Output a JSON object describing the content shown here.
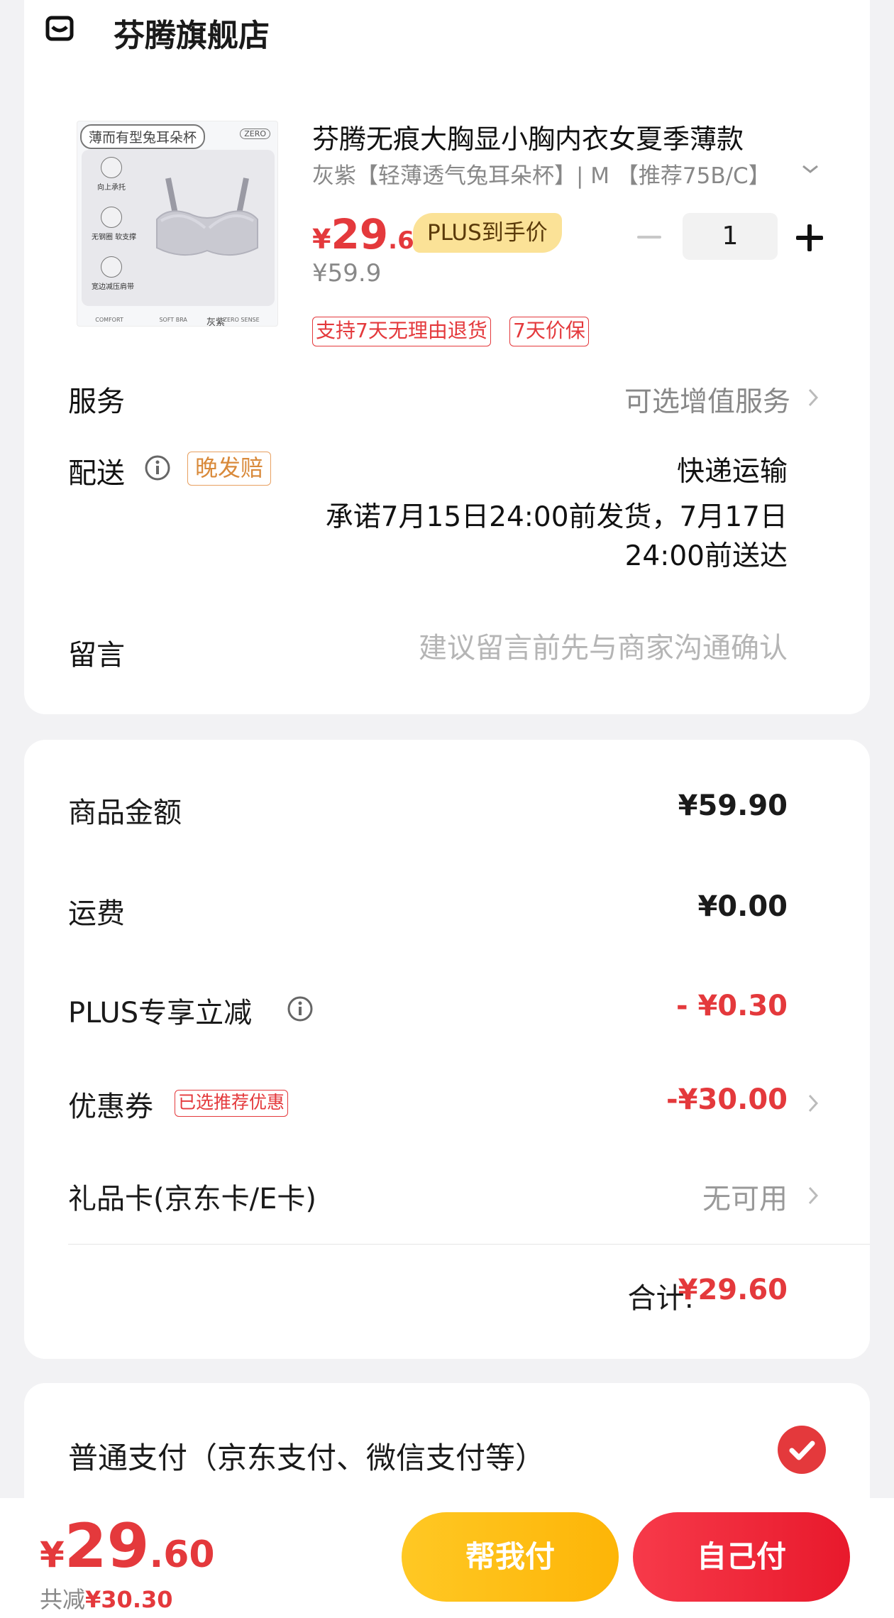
{
  "store": {
    "name": "芬腾旗舰店",
    "icon": "store-icon"
  },
  "product": {
    "title": "芬腾无痕大胸显小胸内衣女夏季薄款",
    "spec": "灰紫【轻薄透气兔耳朵杯】| M 【推荐75B/C】",
    "image_tag": "薄而有型兔耳朵杯",
    "image_badge": "ZERO",
    "image_features": [
      "向上承托",
      "无钢圈 软支撑",
      "宽边减压肩带"
    ],
    "image_color": "灰紫",
    "image_footer": [
      "COMFORT",
      "SOFT BRA",
      "ZERO SENSE"
    ],
    "price_symbol": "¥",
    "price_int": "29",
    "price_dec": ".6",
    "plus_label": "PLUS到手价",
    "original_price": "¥59.9",
    "quantity": "1",
    "badges": [
      "支持7天无理由退货",
      "7天价保"
    ]
  },
  "service": {
    "label": "服务",
    "value": "可选增值服务"
  },
  "delivery": {
    "label": "配送",
    "late_badge": "晚发赔",
    "method": "快递运输",
    "line1": "承诺7月15日24:00前发货，7月17日",
    "line2": "24:00前送达"
  },
  "message": {
    "label": "留言",
    "placeholder": "建议留言前先与商家沟通确认"
  },
  "summary": {
    "goods_label": "商品金额",
    "goods_value": "¥59.90",
    "shipping_label": "运费",
    "shipping_value": "¥0.00",
    "plus_label": "PLUS专享立减",
    "plus_value": "- ¥0.30",
    "coupon_label": "优惠券",
    "coupon_badge": "已选推荐优惠",
    "coupon_value": "-¥30.00",
    "giftcard_label": "礼品卡(京东卡/E卡)",
    "giftcard_value": "无可用",
    "total_label": "合计:",
    "total_value": "¥29.60"
  },
  "payment": {
    "label": "普通支付（京东支付、微信支付等）"
  },
  "bottom": {
    "price_symbol": "¥",
    "price_int": "29",
    "price_dec": ".60",
    "saving_label": "共减",
    "saving_value": "¥30.30",
    "help_pay": "帮我付",
    "self_pay": "自己付"
  },
  "colors": {
    "accent_red": "#e4393c",
    "plus_gold": "#fbe297",
    "help_yellow": "#ffc824"
  }
}
